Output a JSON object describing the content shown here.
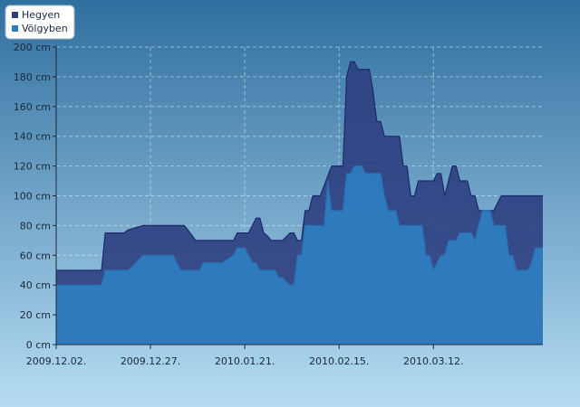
{
  "chart_data": {
    "type": "area",
    "title": "",
    "xlabel": "",
    "ylabel": "",
    "unit": "cm",
    "ylim": [
      0,
      200
    ],
    "y_ticks": [
      0,
      20,
      40,
      60,
      80,
      100,
      120,
      140,
      160,
      180,
      200
    ],
    "y_tick_labels": [
      "0 cm",
      "20 cm",
      "40 cm",
      "60 cm",
      "80 cm",
      "100 cm",
      "120 cm",
      "140 cm",
      "160 cm",
      "180 cm",
      "200 cm"
    ],
    "x_range": [
      "2009.12.02.",
      "2010.04.10."
    ],
    "x_ticks": [
      "2009.12.02.",
      "2009.12.27.",
      "2010.01.21.",
      "2010.02.15.",
      "2010.03.12."
    ],
    "grid": true,
    "legend_position": "top-left",
    "colors": {
      "Hegyen": "#2e3f80",
      "Völgyben": "#2e7cc0",
      "background_top": "#2f6f9f",
      "background_bottom": "#b6dcf3"
    },
    "series": [
      {
        "name": "Hegyen",
        "x": [
          "2009.12.02.",
          "2009.12.14.",
          "2009.12.15.",
          "2009.12.20.",
          "2009.12.21.",
          "2009.12.25.",
          "2009.12.26.",
          "2010.01.04.",
          "2010.01.05.",
          "2010.01.08.",
          "2010.01.09.",
          "2010.01.11.",
          "2010.01.12.",
          "2010.01.13.",
          "2010.01.14.",
          "2010.01.18.",
          "2010.01.19.",
          "2010.01.20.",
          "2010.01.21.",
          "2010.01.22.",
          "2010.01.23.",
          "2010.01.24.",
          "2010.01.25.",
          "2010.01.26.",
          "2010.01.27.",
          "2010.01.28.",
          "2010.01.29.",
          "2010.01.30.",
          "2010.01.31.",
          "2010.02.02.",
          "2010.02.03.",
          "2010.02.04.",
          "2010.02.05.",
          "2010.02.06.",
          "2010.02.07.",
          "2010.02.08.",
          "2010.02.09.",
          "2010.02.10.",
          "2010.02.13.",
          "2010.02.14.",
          "2010.02.15.",
          "2010.02.16.",
          "2010.02.17.",
          "2010.02.18.",
          "2010.02.19.",
          "2010.02.20.",
          "2010.02.21.",
          "2010.02.22.",
          "2010.02.23.",
          "2010.02.24.",
          "2010.02.25.",
          "2010.02.26.",
          "2010.02.27.",
          "2010.02.28.",
          "2010.03.01.",
          "2010.03.02.",
          "2010.03.03.",
          "2010.03.04.",
          "2010.03.05.",
          "2010.03.06.",
          "2010.03.07.",
          "2010.03.08.",
          "2010.03.09.",
          "2010.03.10.",
          "2010.03.11.",
          "2010.03.12.",
          "2010.03.13.",
          "2010.03.14.",
          "2010.03.15.",
          "2010.03.16.",
          "2010.03.17.",
          "2010.03.18.",
          "2010.03.19.",
          "2010.03.20.",
          "2010.03.21.",
          "2010.03.22.",
          "2010.03.23.",
          "2010.03.24.",
          "2010.03.25.",
          "2010.03.26.",
          "2010.03.27.",
          "2010.03.28.",
          "2010.03.29.",
          "2010.03.30.",
          "2010.03.31.",
          "2010.04.01.",
          "2010.04.02.",
          "2010.04.03.",
          "2010.04.04.",
          "2010.04.05.",
          "2010.04.06.",
          "2010.04.07.",
          "2010.04.08.",
          "2010.04.09.",
          "2010.04.10."
        ],
        "values": [
          50,
          50,
          75,
          75,
          77,
          80,
          80,
          80,
          80,
          70,
          70,
          70,
          70,
          70,
          70,
          70,
          75,
          75,
          75,
          75,
          80,
          85,
          85,
          75,
          73,
          70,
          70,
          70,
          70,
          75,
          75,
          70,
          70,
          90,
          90,
          100,
          100,
          100,
          120,
          120,
          120,
          120,
          180,
          190,
          190,
          185,
          185,
          185,
          185,
          170,
          150,
          150,
          140,
          140,
          140,
          140,
          140,
          120,
          120,
          100,
          100,
          110,
          110,
          110,
          110,
          110,
          115,
          115,
          100,
          110,
          120,
          120,
          110,
          110,
          110,
          100,
          100,
          90,
          90,
          90,
          90,
          90,
          95,
          100,
          100,
          100,
          100,
          100,
          100,
          100,
          100,
          100,
          100,
          100,
          100
        ],
        "comment_dummy": ""
      },
      {
        "name": "Völgyben",
        "x": [
          "2009.12.02.",
          "2009.12.14.",
          "2009.12.15.",
          "2009.12.21.",
          "2009.12.22.",
          "2009.12.25.",
          "2009.12.26.",
          "2010.01.01.",
          "2010.01.02.",
          "2010.01.04.",
          "2010.01.05.",
          "2010.01.07.",
          "2010.01.08.",
          "2010.01.09.",
          "2010.01.10.",
          "2010.01.12.",
          "2010.01.13.",
          "2010.01.14.",
          "2010.01.15.",
          "2010.01.18.",
          "2010.01.19.",
          "2010.01.20.",
          "2010.01.21.",
          "2010.01.22.",
          "2010.01.23.",
          "2010.01.24.",
          "2010.01.25.",
          "2010.01.26.",
          "2010.01.27.",
          "2010.01.28.",
          "2010.01.29.",
          "2010.01.30.",
          "2010.01.31.",
          "2010.02.01.",
          "2010.02.02.",
          "2010.02.03.",
          "2010.02.04.",
          "2010.02.05.",
          "2010.02.06.",
          "2010.02.07.",
          "2010.02.08.",
          "2010.02.09.",
          "2010.02.10.",
          "2010.02.11.",
          "2010.02.12.",
          "2010.02.13.",
          "2010.02.14.",
          "2010.02.15.",
          "2010.02.16.",
          "2010.02.17.",
          "2010.02.18.",
          "2010.02.19.",
          "2010.02.20.",
          "2010.02.21.",
          "2010.02.22.",
          "2010.02.23.",
          "2010.02.24.",
          "2010.02.25.",
          "2010.02.26.",
          "2010.02.27.",
          "2010.02.28.",
          "2010.03.01.",
          "2010.03.02.",
          "2010.03.03.",
          "2010.03.04.",
          "2010.03.05.",
          "2010.03.06.",
          "2010.03.07.",
          "2010.03.08.",
          "2010.03.09.",
          "2010.03.10.",
          "2010.03.11.",
          "2010.03.12.",
          "2010.03.13.",
          "2010.03.14.",
          "2010.03.15.",
          "2010.03.16.",
          "2010.03.17.",
          "2010.03.18.",
          "2010.03.19.",
          "2010.03.20.",
          "2010.03.21.",
          "2010.03.22.",
          "2010.03.23.",
          "2010.03.24.",
          "2010.03.25.",
          "2010.03.26.",
          "2010.03.27.",
          "2010.03.28.",
          "2010.03.29.",
          "2010.03.30.",
          "2010.03.31.",
          "2010.04.01.",
          "2010.04.02.",
          "2010.04.03.",
          "2010.04.04.",
          "2010.04.05.",
          "2010.04.06.",
          "2010.04.07.",
          "2010.04.08.",
          "2010.04.09.",
          "2010.04.10."
        ],
        "values": [
          40,
          40,
          50,
          50,
          52,
          60,
          60,
          60,
          60,
          50,
          50,
          50,
          50,
          50,
          55,
          55,
          55,
          55,
          55,
          60,
          65,
          65,
          65,
          60,
          55,
          55,
          50,
          50,
          50,
          50,
          50,
          45,
          45,
          42,
          40,
          40,
          60,
          60,
          80,
          80,
          80,
          80,
          80,
          80,
          110,
          90,
          90,
          90,
          90,
          115,
          115,
          120,
          120,
          120,
          115,
          115,
          115,
          115,
          115,
          100,
          90,
          90,
          90,
          80,
          80,
          80,
          80,
          80,
          80,
          80,
          60,
          60,
          50,
          55,
          60,
          60,
          70,
          70,
          70,
          75,
          75,
          75,
          75,
          70,
          80,
          90,
          90,
          90,
          80,
          80,
          80,
          80,
          60,
          60,
          50,
          50,
          50,
          50,
          55,
          65,
          65,
          65
        ]
      }
    ]
  }
}
